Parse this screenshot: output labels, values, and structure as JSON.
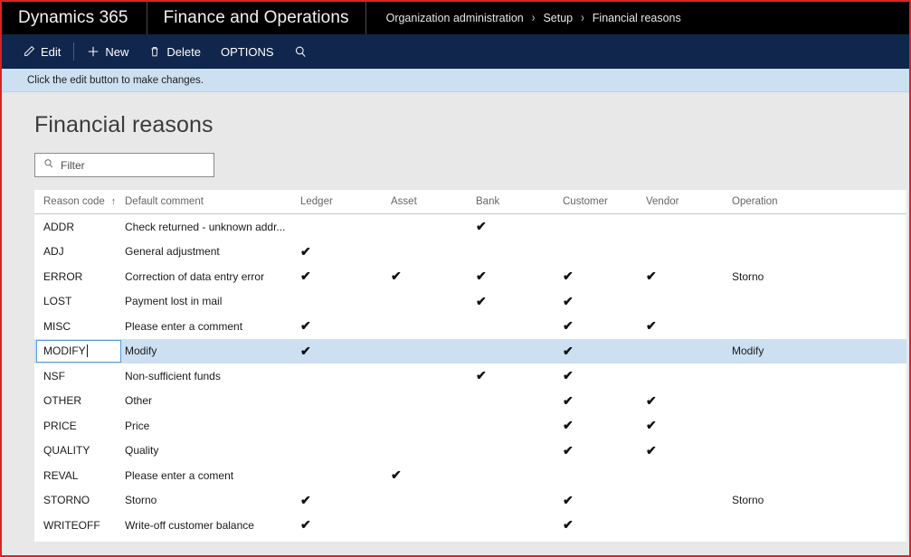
{
  "titlebar": {
    "brand": "Dynamics 365",
    "app": "Finance and Operations",
    "breadcrumb": [
      "Organization administration",
      "Setup",
      "Financial reasons"
    ],
    "separator": "›"
  },
  "toolbar": {
    "edit_label": "Edit",
    "new_label": "New",
    "delete_label": "Delete",
    "options_label": "OPTIONS",
    "search_icon": "search-icon"
  },
  "message_bar": {
    "text": "Click the edit button to make changes."
  },
  "page": {
    "title": "Financial reasons"
  },
  "filter": {
    "placeholder": "Filter",
    "value": "",
    "icon": "search-icon"
  },
  "grid": {
    "columns": [
      {
        "key": "code",
        "label": "Reason code",
        "sorted": true,
        "sort_glyph": "↑"
      },
      {
        "key": "comment",
        "label": "Default comment"
      },
      {
        "key": "ledger",
        "label": "Ledger"
      },
      {
        "key": "asset",
        "label": "Asset"
      },
      {
        "key": "bank",
        "label": "Bank"
      },
      {
        "key": "customer",
        "label": "Customer"
      },
      {
        "key": "vendor",
        "label": "Vendor"
      },
      {
        "key": "operation",
        "label": "Operation"
      }
    ],
    "check_glyph": "✔",
    "rows": [
      {
        "code": "ADDR",
        "comment": "Check returned - unknown addr...",
        "ledger": false,
        "asset": false,
        "bank": true,
        "customer": false,
        "vendor": false,
        "operation": "",
        "selected": false
      },
      {
        "code": "ADJ",
        "comment": "General adjustment",
        "ledger": true,
        "asset": false,
        "bank": false,
        "customer": false,
        "vendor": false,
        "operation": "",
        "selected": false
      },
      {
        "code": "ERROR",
        "comment": "Correction of data entry error",
        "ledger": true,
        "asset": true,
        "bank": true,
        "customer": true,
        "vendor": true,
        "operation": "Storno",
        "selected": false,
        "operation_highlighted": true
      },
      {
        "code": "LOST",
        "comment": "Payment lost in mail",
        "ledger": false,
        "asset": false,
        "bank": true,
        "customer": true,
        "vendor": false,
        "operation": "",
        "selected": false
      },
      {
        "code": "MISC",
        "comment": "Please enter a comment",
        "ledger": true,
        "asset": false,
        "bank": false,
        "customer": true,
        "vendor": true,
        "operation": "",
        "selected": false
      },
      {
        "code": "MODIFY",
        "comment": "Modify",
        "ledger": true,
        "asset": false,
        "bank": false,
        "customer": true,
        "vendor": false,
        "operation": "Modify",
        "selected": true,
        "editing": true,
        "operation_highlighted": true
      },
      {
        "code": "NSF",
        "comment": "Non-sufficient funds",
        "ledger": false,
        "asset": false,
        "bank": true,
        "customer": true,
        "vendor": false,
        "operation": "",
        "selected": false
      },
      {
        "code": "OTHER",
        "comment": "Other",
        "ledger": false,
        "asset": false,
        "bank": false,
        "customer": true,
        "vendor": true,
        "operation": "",
        "selected": false
      },
      {
        "code": "PRICE",
        "comment": "Price",
        "ledger": false,
        "asset": false,
        "bank": false,
        "customer": true,
        "vendor": true,
        "operation": "",
        "selected": false
      },
      {
        "code": "QUALITY",
        "comment": "Quality",
        "ledger": false,
        "asset": false,
        "bank": false,
        "customer": true,
        "vendor": true,
        "operation": "",
        "selected": false
      },
      {
        "code": "REVAL",
        "comment": "Please enter a coment",
        "ledger": false,
        "asset": true,
        "bank": false,
        "customer": false,
        "vendor": false,
        "operation": "",
        "selected": false
      },
      {
        "code": "STORNO",
        "comment": "Storno",
        "ledger": true,
        "asset": false,
        "bank": false,
        "customer": true,
        "vendor": false,
        "operation": "Storno",
        "selected": false,
        "operation_highlighted": true
      },
      {
        "code": "WRITEOFF",
        "comment": "Write-off customer balance",
        "ledger": true,
        "asset": false,
        "bank": false,
        "customer": true,
        "vendor": false,
        "operation": "",
        "selected": false
      }
    ]
  },
  "annotation": {
    "color": "#e02020",
    "border_color": "#d42626"
  }
}
